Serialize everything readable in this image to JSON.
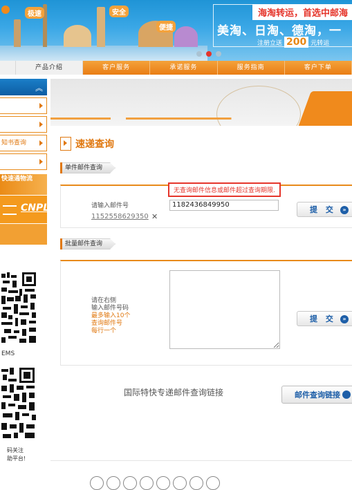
{
  "banner": {
    "tags": [
      "极速",
      "安全",
      "便捷"
    ],
    "promo_top": "海淘转运，首选中邮海",
    "promo_mid": "美淘、日淘、德淘，一",
    "promo_low_prefix": "注册立送",
    "promo_low_num": "200",
    "promo_low_suffix": "元转运"
  },
  "nav": {
    "items": [
      "产品介绍",
      "客户服务",
      "承诺服务",
      "服务指南",
      "客户下单"
    ]
  },
  "sidebar": {
    "item3_label": "知书查询",
    "banner1": "快速通物流",
    "cnpl": "CNPL",
    "qr1_label": "EMS",
    "qr_note_line1": "码关注",
    "qr_note_line2": "助平台!"
  },
  "main": {
    "title": "速递查询",
    "single_tab": "单件邮件查询",
    "error_message": "无查询邮件信息或邮件超过查询期限.",
    "input_label": "请输入邮件号",
    "input_value": "1182436849950",
    "history_number": "1152558629350",
    "submit_label": "提 交",
    "batch_tab": "批量邮件查询",
    "instructions": {
      "line1": "请在右侧",
      "line2": "输入邮件号码",
      "line3": "最多输入10个",
      "line4": "查询邮件号",
      "line5": "每行一个"
    },
    "batch_submit_label": "提 交",
    "link_title": "国际特快专递邮件查询链接",
    "link_button": "邮件查询链接"
  },
  "colors": {
    "accent_orange": "#e07810",
    "nav_orange": "#ea8517",
    "link_blue": "#1e5fa8",
    "error_red": "#e5352b"
  }
}
